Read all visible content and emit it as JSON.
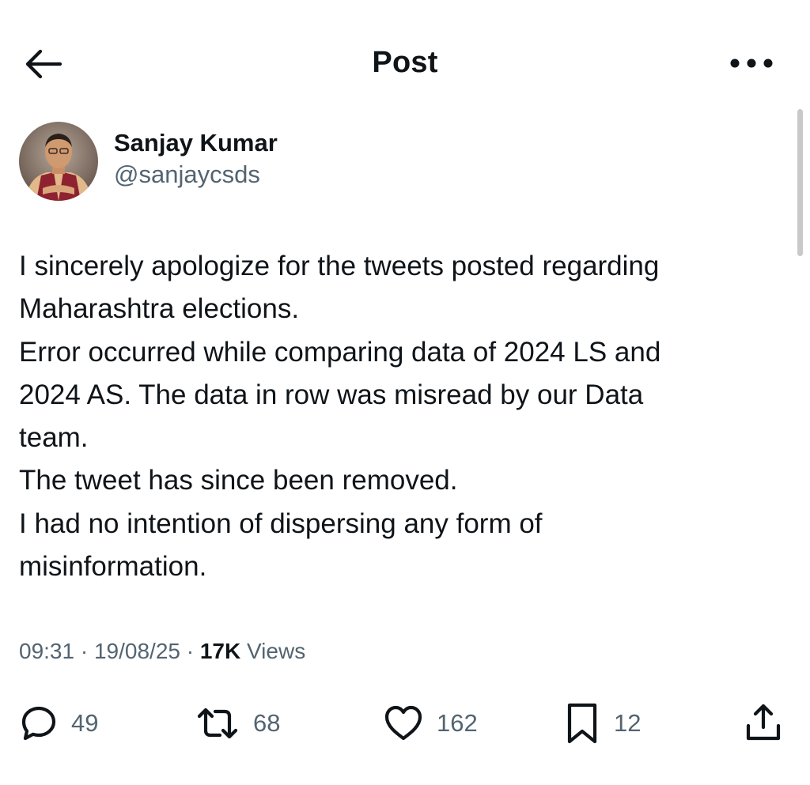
{
  "header": {
    "title": "Post",
    "back_icon": "arrow-left-icon",
    "more_icon": "more-horizontal-icon"
  },
  "author": {
    "display_name": "Sanjay Kumar",
    "handle": "@sanjaycsds"
  },
  "tweet": {
    "lines": [
      "I sincerely apologize for the tweets posted regarding",
      "Maharashtra elections.",
      "Error occurred while comparing data of 2024 LS and",
      "2024 AS. The data in row was misread by our Data",
      "team.",
      "The tweet has since been removed.",
      "I had no intention of dispersing any form of",
      "misinformation."
    ]
  },
  "meta": {
    "time": "09:31",
    "date": "19/08/25",
    "separator": " · ",
    "views_count": "17K",
    "views_label": "Views"
  },
  "actions": {
    "replies": "49",
    "reposts": "68",
    "likes": "162",
    "bookmarks": "12"
  },
  "colors": {
    "text_primary": "#0f1419",
    "text_secondary": "#536471",
    "background": "#ffffff"
  }
}
